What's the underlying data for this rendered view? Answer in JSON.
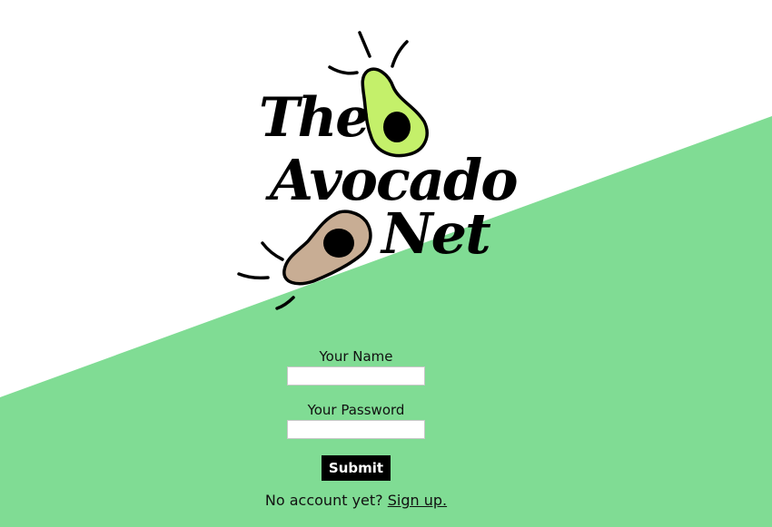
{
  "colors": {
    "background_top": "#ffffff",
    "background_bottom": "#80dc94",
    "avocado_green": "#c4f06a",
    "avocado_tan": "#c8ad94",
    "text": "#111111",
    "button_bg": "#000000",
    "button_text": "#ffffff"
  },
  "logo": {
    "word1": "The",
    "word2": "Avocado",
    "word3": "Net",
    "icons": [
      "avocado-green-icon",
      "avocado-tan-icon"
    ]
  },
  "form": {
    "name_label": "Your Name",
    "name_value": "",
    "password_label": "Your Password",
    "password_value": "",
    "submit_label": "Submit"
  },
  "signup": {
    "prompt": "No account yet?",
    "link_text": "Sign up."
  }
}
